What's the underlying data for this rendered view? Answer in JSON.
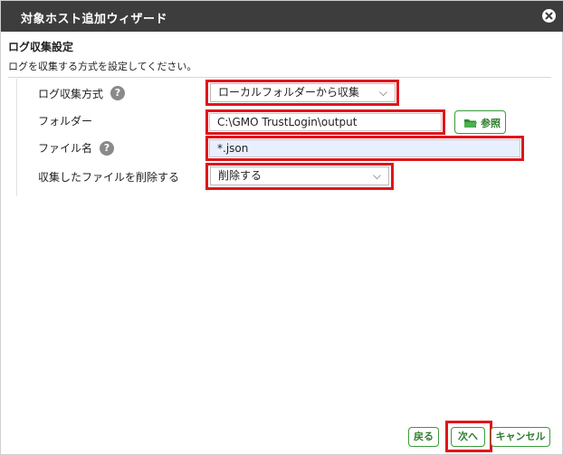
{
  "dialog": {
    "title": "対象ホスト追加ウィザード",
    "close_icon": "close-icon"
  },
  "section": {
    "title": "ログ収集設定",
    "description": "ログを収集する方式を設定してください。"
  },
  "form": {
    "method": {
      "label": "ログ収集方式",
      "value": "ローカルフォルダーから収集",
      "help_icon": "help-icon"
    },
    "folder": {
      "label": "フォルダー",
      "value": "C:\\GMO TrustLogin\\output",
      "browse_label": "参照",
      "browse_icon": "folder-icon"
    },
    "filename": {
      "label": "ファイル名",
      "value": "*.json",
      "help_icon": "help-icon"
    },
    "delete": {
      "label": "収集したファイルを削除する",
      "value": "削除する"
    }
  },
  "footer": {
    "back_label": "戻る",
    "next_label": "次へ",
    "cancel_label": "キャンセル"
  },
  "colors": {
    "titlebar": "#3d3d3d",
    "highlight": "#e0151b",
    "button_accent": "#3b9b3b",
    "input_blue": "#e8efff"
  }
}
